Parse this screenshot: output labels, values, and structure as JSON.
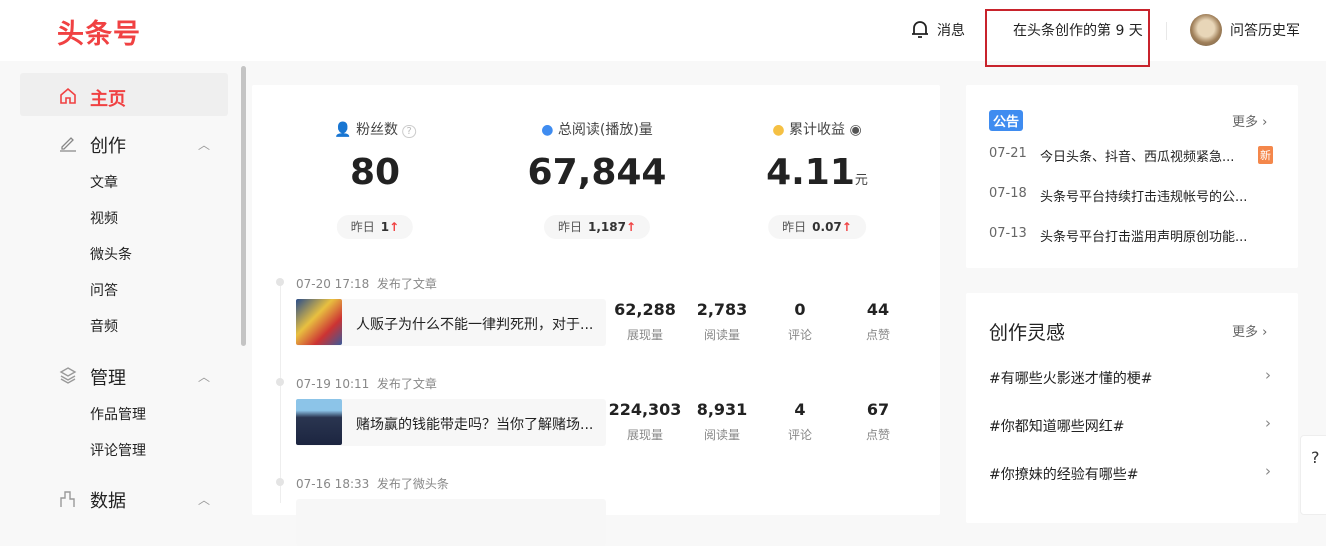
{
  "header": {
    "logo": "头条号",
    "messages": "消息",
    "creation_days": "在头条创作的第 9 天",
    "username": "问答历史军"
  },
  "sidebar": {
    "home": "主页",
    "create": {
      "label": "创作",
      "items": [
        "文章",
        "视频",
        "微头条",
        "问答",
        "音频"
      ]
    },
    "manage": {
      "label": "管理",
      "items": [
        "作品管理",
        "评论管理"
      ]
    },
    "data": {
      "label": "数据"
    }
  },
  "stats": [
    {
      "label": "粉丝数",
      "value": "80",
      "unit": "",
      "yesterday_label": "昨日",
      "yesterday": "1"
    },
    {
      "label": "总阅读(播放)量",
      "value": "67,844",
      "unit": "",
      "yesterday_label": "昨日",
      "yesterday": "1,187"
    },
    {
      "label": "累计收益",
      "value": "4.11",
      "unit": "元",
      "yesterday_label": "昨日",
      "yesterday": "0.07"
    }
  ],
  "metric_labels": [
    "展现量",
    "阅读量",
    "评论",
    "点赞"
  ],
  "feed": [
    {
      "time": "07-20 17:18",
      "action": "发布了文章",
      "title": "人贩子为什么不能一律判死刑，对于...",
      "metrics": [
        "62,288",
        "2,783",
        "0",
        "44"
      ]
    },
    {
      "time": "07-19 10:11",
      "action": "发布了文章",
      "title": "赌场赢的钱能带走吗？当你了解赌场...",
      "metrics": [
        "224,303",
        "8,931",
        "4",
        "67"
      ]
    },
    {
      "time": "07-16 18:33",
      "action": "发布了微头条"
    }
  ],
  "notices": {
    "tag": "公告",
    "more": "更多",
    "new_badge": "新",
    "items": [
      {
        "date": "07-21",
        "title": "今日头条、抖音、西瓜视频紧急..."
      },
      {
        "date": "07-18",
        "title": "头条号平台持续打击违规帐号的公..."
      },
      {
        "date": "07-13",
        "title": "头条号平台打击滥用声明原创功能..."
      }
    ]
  },
  "inspiration": {
    "title": "创作灵感",
    "more": "更多",
    "items": [
      "#有哪些火影迷才懂的梗#",
      "#你都知道哪些网红#",
      "#你撩妹的经验有哪些#"
    ]
  }
}
